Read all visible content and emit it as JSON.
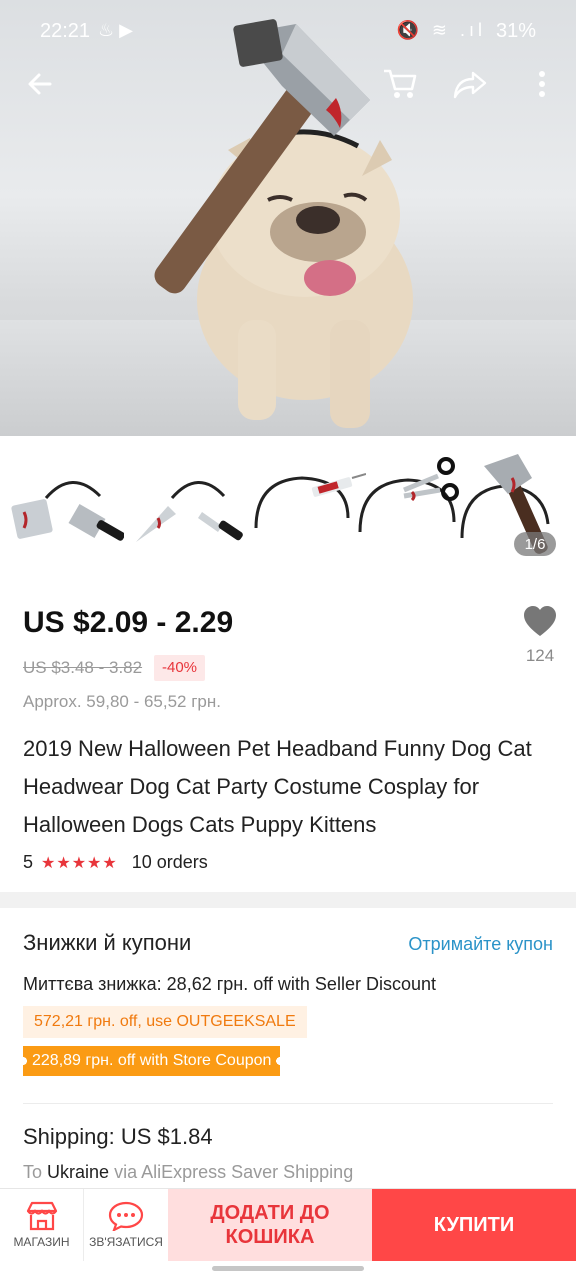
{
  "status": {
    "time": "22:21",
    "left_icons": "♨ ▶",
    "right_icons": "🔇 ≋ .ıl",
    "battery": "31%"
  },
  "topbar": {
    "back_icon": "arrow-left-icon",
    "cart_icon": "cart-icon",
    "share_icon": "share-icon",
    "more_icon": "more-icon"
  },
  "gallery": {
    "counter": "1/6"
  },
  "product": {
    "price": "US $2.09 - 2.29",
    "old_price": "US $3.48 - 3.82",
    "discount": "-40%",
    "approx": "Approx. 59,80 - 65,52 грн.",
    "wishlist_count": "124",
    "title": "2019 New Halloween Pet Headband Funny Dog Cat Headwear Dog Cat Party Costume Cosplay for Halloween Dogs Cats Puppy Kittens",
    "rating": "5",
    "stars": "★★★★★",
    "orders": "10 orders"
  },
  "coupons": {
    "title": "Знижки й купони",
    "get_coupon": "Отримайте купон",
    "instant": "Миттєва знижка: 28,62 грн. off with Seller Discount",
    "coupon_seller": "572,21 грн. off, use OUTGEEKSALE",
    "coupon_store": "228,89 грн. off with Store Coupon"
  },
  "shipping": {
    "title": "Shipping: US $1.84",
    "to_label": "To",
    "country": "Ukraine",
    "via": "via AliExpress Saver Shipping"
  },
  "bottom": {
    "store": "МАГАЗИН",
    "contact": "ЗВ'ЯЗАТИСЯ",
    "add_to_cart": "ДОДАТИ ДО КОШИКА",
    "buy": "КУПИТИ"
  },
  "colors": {
    "accent": "#ff4747",
    "accent_light": "#ffdede",
    "link": "#2b93c8",
    "coupon_orange": "#fb9b14"
  }
}
